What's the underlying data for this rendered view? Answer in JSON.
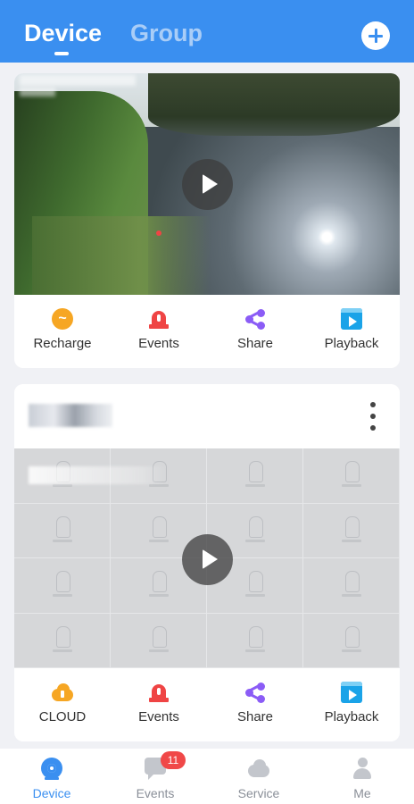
{
  "header": {
    "tabs": [
      {
        "label": "Device",
        "active": true
      },
      {
        "label": "Group",
        "active": false
      }
    ],
    "add_icon": "plus-circle-icon"
  },
  "cards": [
    {
      "has_name_row": false,
      "actions": [
        {
          "label": "Recharge",
          "icon": "recharge-icon"
        },
        {
          "label": "Events",
          "icon": "alarm-light-icon",
          "has_dot": true
        },
        {
          "label": "Share",
          "icon": "share-icon"
        },
        {
          "label": "Playback",
          "icon": "playback-icon"
        }
      ]
    },
    {
      "has_name_row": true,
      "device_name": "██████",
      "device_id": "ID: ████████",
      "actions": [
        {
          "label": "CLOUD",
          "icon": "cloud-upload-icon"
        },
        {
          "label": "Events",
          "icon": "alarm-light-icon"
        },
        {
          "label": "Share",
          "icon": "share-icon"
        },
        {
          "label": "Playback",
          "icon": "playback-icon"
        }
      ]
    }
  ],
  "tabbar": [
    {
      "label": "Device",
      "icon": "camera-icon",
      "active": true
    },
    {
      "label": "Events",
      "icon": "message-icon",
      "badge": "11"
    },
    {
      "label": "Service",
      "icon": "cloud-icon"
    },
    {
      "label": "Me",
      "icon": "user-icon"
    }
  ],
  "colors": {
    "primary": "#3a8ff0",
    "alert": "#ef4444",
    "share": "#8b5cf6",
    "recharge": "#f6a623",
    "playback": "#1aa3e8"
  }
}
